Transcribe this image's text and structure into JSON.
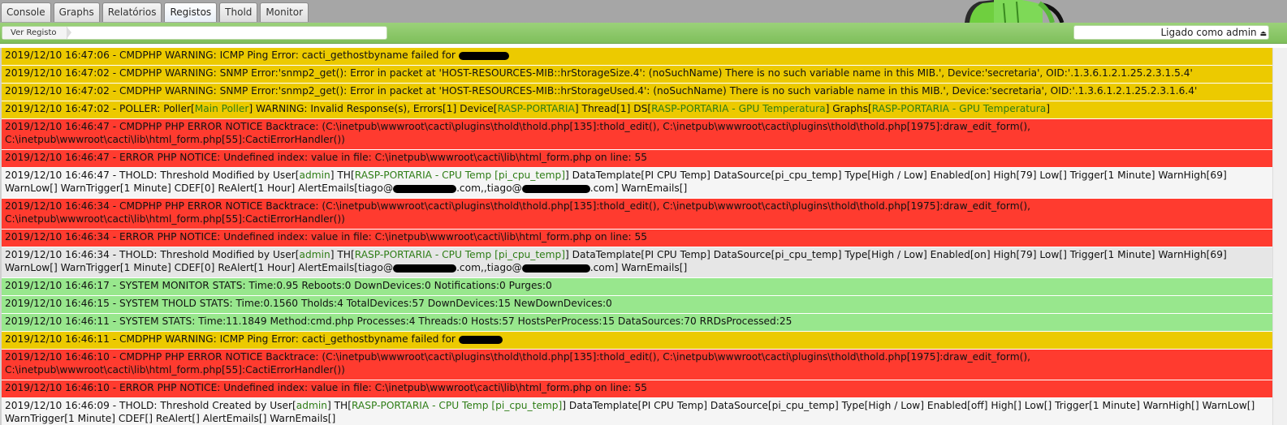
{
  "tabs": [
    "Console",
    "Graphs",
    "Relatórios",
    "Registos",
    "Thold",
    "Monitor"
  ],
  "active_tab": "Registos",
  "breadcrumb": "Ver Registo",
  "login_status": "Ligado como admin",
  "log": {
    "r1": {
      "a": "2019/12/10 16:47:06 - CMDPHP WARNING: ICMP Ping Error: cacti_gethostbyname failed for "
    },
    "r2": {
      "a": "2019/12/10 16:47:02 - CMDPHP WARNING: SNMP Error:'snmp2_get(): Error in packet at 'HOST-RESOURCES-MIB::hrStorageSize.4': (noSuchName) There is no such variable name in this MIB.', Device:'secretaria', OID:'.1.3.6.1.2.1.25.2.3.1.5.4'"
    },
    "r3": {
      "a": "2019/12/10 16:47:02 - CMDPHP WARNING: SNMP Error:'snmp2_get(): Error in packet at 'HOST-RESOURCES-MIB::hrStorageUsed.4': (noSuchName) There is no such variable name in this MIB.', Device:'secretaria', OID:'.1.3.6.1.2.1.25.2.3.1.6.4'"
    },
    "r4": {
      "a": "2019/12/10 16:47:02 - POLLER: Poller[",
      "b": "Main Poller",
      "c": "] WARNING: Invalid Response(s), Errors[1] Device[",
      "d": "RASP-PORTARIA",
      "e": "] Thread[1] DS[",
      "f": "RASP-PORTARIA - GPU Temperatura",
      "g": "] Graphs[",
      "h": "RASP-PORTARIA - GPU Temperatura",
      "i": "]"
    },
    "r5": {
      "a": "2019/12/10 16:46:47 - CMDPHP PHP ERROR NOTICE Backtrace: (C:\\inetpub\\wwwroot\\cacti\\plugins\\thold\\thold.php[135]:thold_edit(), C:\\inetpub\\wwwroot\\cacti\\plugins\\thold\\thold.php[1975]:draw_edit_form(),\nC:\\inetpub\\wwwroot\\cacti\\lib\\html_form.php[55]:CactiErrorHandler())"
    },
    "r6": {
      "a": "2019/12/10 16:46:47 - ERROR PHP NOTICE: Undefined index: value in file: C:\\inetpub\\wwwroot\\cacti\\lib\\html_form.php on line: 55"
    },
    "r7": {
      "a": "2019/12/10 16:46:47 - THOLD: Threshold Modified by User[",
      "b": "admin",
      "c": "] TH[",
      "d": "RASP-PORTARIA - CPU Temp [pi_cpu_temp]",
      "e": "] DataTemplate[PI CPU Temp] DataSource[pi_cpu_temp] Type[High / Low] Enabled[on] High[79] Low[] Trigger[1 Minute] WarnHigh[69]\nWarnLow[] WarnTrigger[1 Minute] CDEF[0] ReAlert[1 Hour] AlertEmails[tiago@",
      "f": ".com,,tiago@",
      "g": ".com] WarnEmails[]"
    },
    "r8": {
      "a": "2019/12/10 16:46:34 - CMDPHP PHP ERROR NOTICE Backtrace: (C:\\inetpub\\wwwroot\\cacti\\plugins\\thold\\thold.php[135]:thold_edit(), C:\\inetpub\\wwwroot\\cacti\\plugins\\thold\\thold.php[1975]:draw_edit_form(),\nC:\\inetpub\\wwwroot\\cacti\\lib\\html_form.php[55]:CactiErrorHandler())"
    },
    "r9": {
      "a": "2019/12/10 16:46:34 - ERROR PHP NOTICE: Undefined index: value in file: C:\\inetpub\\wwwroot\\cacti\\lib\\html_form.php on line: 55"
    },
    "r10": {
      "a": "2019/12/10 16:46:34 - THOLD: Threshold Modified by User[",
      "b": "admin",
      "c": "] TH[",
      "d": "RASP-PORTARIA - CPU Temp [pi_cpu_temp]",
      "e": "] DataTemplate[PI CPU Temp] DataSource[pi_cpu_temp] Type[High / Low] Enabled[on] High[79] Low[] Trigger[1 Minute] WarnHigh[69]\nWarnLow[] WarnTrigger[1 Minute] CDEF[0] ReAlert[1 Hour] AlertEmails[tiago@",
      "f": ".com,,tiago@",
      "g": ".com] WarnEmails[]"
    },
    "r11": {
      "a": "2019/12/10 16:46:17 - SYSTEM MONITOR STATS: Time:0.95 Reboots:0 DownDevices:0 Notifications:0 Purges:0"
    },
    "r12": {
      "a": "2019/12/10 16:46:15 - SYSTEM THOLD STATS: Time:0.1560 Tholds:4 TotalDevices:57 DownDevices:15 NewDownDevices:0"
    },
    "r13": {
      "a": "2019/12/10 16:46:11 - SYSTEM STATS: Time:11.1849 Method:cmd.php Processes:4 Threads:0 Hosts:57 HostsPerProcess:15 DataSources:70 RRDsProcessed:25"
    },
    "r14": {
      "a": "2019/12/10 16:46:11 - CMDPHP WARNING: ICMP Ping Error: cacti_gethostbyname failed for "
    },
    "r15": {
      "a": "2019/12/10 16:46:10 - CMDPHP PHP ERROR NOTICE Backtrace: (C:\\inetpub\\wwwroot\\cacti\\plugins\\thold\\thold.php[135]:thold_edit(), C:\\inetpub\\wwwroot\\cacti\\plugins\\thold\\thold.php[1975]:draw_edit_form(),\nC:\\inetpub\\wwwroot\\cacti\\lib\\html_form.php[55]:CactiErrorHandler())"
    },
    "r16": {
      "a": "2019/12/10 16:46:10 - ERROR PHP NOTICE: Undefined index: value in file: C:\\inetpub\\wwwroot\\cacti\\lib\\html_form.php on line: 55"
    },
    "r17": {
      "a": "2019/12/10 16:46:09 - THOLD: Threshold Created by User[",
      "b": "admin",
      "c": "] TH[",
      "d": "RASP-PORTARIA - CPU Temp [pi_cpu_temp]",
      "e": "] DataTemplate[PI CPU Temp] DataSource[pi_cpu_temp] Type[High / Low] Enabled[off] High[] Low[] Trigger[1 Minute] WarnHigh[] WarnLow[]\nWarnTrigger[1 Minute] CDEF[] ReAlert[] AlertEmails[] WarnEmails[]"
    }
  },
  "colors": {
    "warning": "#ecca00",
    "error": "#ff3b2f",
    "stats": "#98e78d",
    "info": "#f5f5f5",
    "highlight_text": "#2e7d16"
  }
}
